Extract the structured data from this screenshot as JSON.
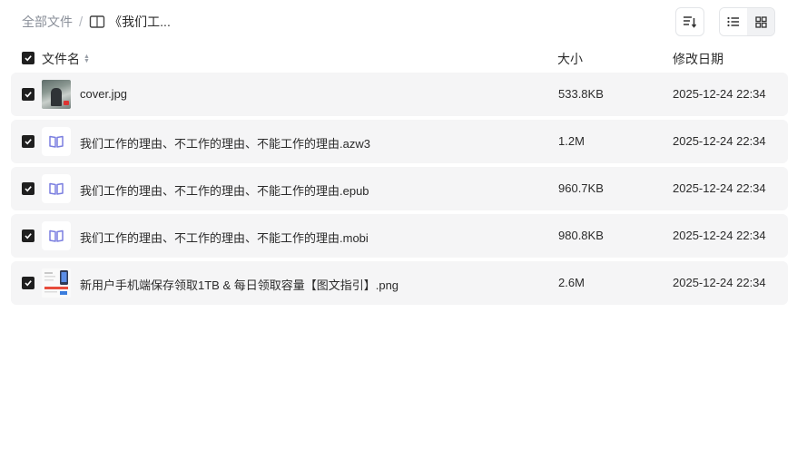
{
  "breadcrumb": {
    "root": "全部文件",
    "separator": "/",
    "current": "《我们工..."
  },
  "toolbar": {
    "sort_icon": "sort-lines-icon",
    "view_list_icon": "list-view-icon",
    "view_grid_icon": "grid-view-icon",
    "active_view": "list"
  },
  "header": {
    "name": "文件名",
    "size": "大小",
    "date": "修改日期"
  },
  "files": [
    {
      "name": "cover.jpg",
      "size": "533.8KB",
      "date": "2025-12-24 22:34",
      "type": "image"
    },
    {
      "name": "我们工作的理由、不工作的理由、不能工作的理由.azw3",
      "size": "1.2M",
      "date": "2025-12-24 22:34",
      "type": "book"
    },
    {
      "name": "我们工作的理由、不工作的理由、不能工作的理由.epub",
      "size": "960.7KB",
      "date": "2025-12-24 22:34",
      "type": "book"
    },
    {
      "name": "我们工作的理由、不工作的理由、不能工作的理由.mobi",
      "size": "980.8KB",
      "date": "2025-12-24 22:34",
      "type": "book"
    },
    {
      "name": "新用户手机端保存领取1TB & 每日领取容量【图文指引】.png",
      "size": "2.6M",
      "date": "2025-12-24 22:34",
      "type": "image"
    }
  ],
  "colors": {
    "row_bg": "#f5f5f6",
    "book_icon": "#7b7fe0",
    "checkbox": "#1f1f1f"
  }
}
